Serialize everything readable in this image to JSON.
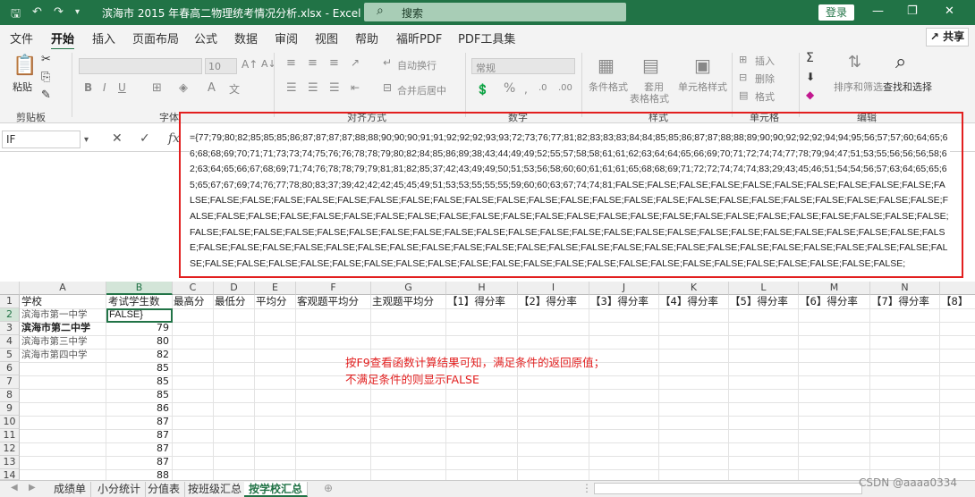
{
  "titlebar": {
    "title": "滨海市 2015 年春高二物理统考情况分析.xlsx  -  Excel",
    "search_placeholder": "搜索",
    "login_label": "登录",
    "icons": [
      "save-icon",
      "undo-icon",
      "redo-icon",
      "customize-icon",
      "search-icon",
      "minimize-icon",
      "restore-icon",
      "close-icon"
    ]
  },
  "tabs": [
    "文件",
    "开始",
    "插入",
    "页面布局",
    "公式",
    "数据",
    "审阅",
    "视图",
    "帮助",
    "福昕PDF",
    "PDF工具集"
  ],
  "active_tab": "开始",
  "share_label": "共享",
  "ribbon": {
    "paste_label": "粘贴",
    "font_size": "10",
    "wrap_label": "自动换行",
    "merge_label": "合并后居中",
    "number_format": "常规",
    "cond_format_label": "条件格式",
    "table_format_label1": "套用",
    "table_format_label2": "表格格式",
    "cell_style_label": "单元格样式",
    "insert_label": "插入",
    "delete_label": "删除",
    "format_label": "格式",
    "sort_filter_label": "排序和筛选",
    "find_select_label": "查找和选择",
    "groups": {
      "clipboard": "剪贴板",
      "font": "字体",
      "align": "对齐方式",
      "number": "数字",
      "styles": "样式",
      "cells": "单元格",
      "edit": "编辑"
    }
  },
  "formula_bar": {
    "name_box": "IF",
    "cancel": "✕",
    "confirm": "✓",
    "fx": "fx",
    "formula": "={77;79;80;82;85;85;85;86;87;87;87;87;88;88;90;90;90;91;91;92;92;92;93;93;72;73;76;77;81;82;83;83;83;84;84;85;85;86;87;87;88;88;89;90;90;92;92;92;94;94;95;56;57;57;60;64;65;66;68;68;69;70;71;71;73;73;74;75;76;76;78;78;79;80;82;84;85;86;89;38;43;44;49;49;52;55;57;58;58;61;61;62;63;64;64;65;66;69;70;71;72;74;74;77;78;79;94;47;51;53;55;56;56;56;58;62;63;64;65;66;67;68;69;71;74;76;78;78;79;79;81;81;82;85;37;42;43;49;49;50;51;53;56;58;60;60;61;61;61;65;68;68;69;71;72;72;74;74;74;83;29;43;45;46;51;54;54;56;57;63;64;65;65;65;65;67;67;69;74;76;77;78;80;83;37;39;42;42;42;45;45;49;51;53;53;55;55;55;59;60;60;63;67;74;74;81;FALSE;FALSE;FALSE;FALSE;FALSE;FALSE;FALSE;FALSE;FALSE;FALSE;FALSE;FALSE;FALSE;FALSE;FALSE;FALSE;FALSE;FALSE;FALSE;FALSE;FALSE;FALSE;FALSE;FALSE;FALSE;FALSE;FALSE;FALSE;FALSE;FALSE;FALSE;FALSE;FALSE;FALSE;FALSE;FALSE;FALSE;FALSE;FALSE;FALSE;FALSE;FALSE;FALSE;FALSE;FALSE;FALSE;FALSE;FALSE;FALSE;FALSE;FALSE;FALSE;FALSE;FALSE;FALSE;FALSE;FALSE;FALSE;FALSE;FALSE;FALSE;FALSE;FALSE;FALSE;FALSE;FALSE;FALSE;FALSE;FALSE;FALSE;FALSE;FALSE;FALSE;FALSE;FALSE;FALSE;FALSE;FALSE;FALSE;FALSE;FALSE;FALSE;FALSE;FALSE;FALSE;FALSE;FALSE;FALSE;FALSE;FALSE;FALSE;FALSE;FALSE;FALSE;FALSE;FALSE;FALSE;FALSE;FALSE;FALSE;FALSE;FALSE;FALSE;FALSE;FALSE;FALSE;FALSE;FALSE;FALSE;FALSE;FALSE;FALSE;FALSE;FALSE;FALSE;FALSE;FALSE;FALSE;FALSE;FALSE;FALSE;FALSE;FALSE;FALSE;FALSE;FALSE;FALSE;FALSE;"
  },
  "sheet": {
    "col_letters": [
      "A",
      "B",
      "C",
      "D",
      "E",
      "F",
      "G",
      "H",
      "I",
      "J",
      "K",
      "L",
      "M",
      "N"
    ],
    "headers": [
      "学校",
      "考试学生数",
      "最高分",
      "最低分",
      "平均分",
      "客观题平均分",
      "主观题平均分",
      "【1】得分率",
      "【2】得分率",
      "【3】得分率",
      "【4】得分率",
      "【5】得分率",
      "【6】得分率",
      "【7】得分率",
      "【8】"
    ],
    "row_numbers": [
      "1",
      "2",
      "3",
      "4",
      "5",
      "6",
      "7",
      "8",
      "9",
      "10",
      "11",
      "12",
      "13",
      "14"
    ],
    "schools": [
      "滨海市第一中学",
      "滨海市第二中学",
      "滨海市第三中学",
      "滨海市第四中学"
    ],
    "b2_value": "FALSE}",
    "b_values": [
      "79",
      "80",
      "82",
      "85",
      "85",
      "85",
      "86",
      "87",
      "87",
      "87",
      "87",
      "88"
    ]
  },
  "annotation": {
    "line1": "按F9查看函数计算结果可知，满足条件的返回原值；",
    "line2": "不满足条件的则显示FALSE"
  },
  "sheet_tabs": [
    "成绩单",
    "小分统计",
    "分值表",
    "按班级汇总",
    "按学校汇总"
  ],
  "active_sheet": "按学校汇总",
  "watermark": "CSDN @aaaa0334",
  "colors": {
    "excel_green": "#217346",
    "annotation_red": "#e21f1f"
  }
}
